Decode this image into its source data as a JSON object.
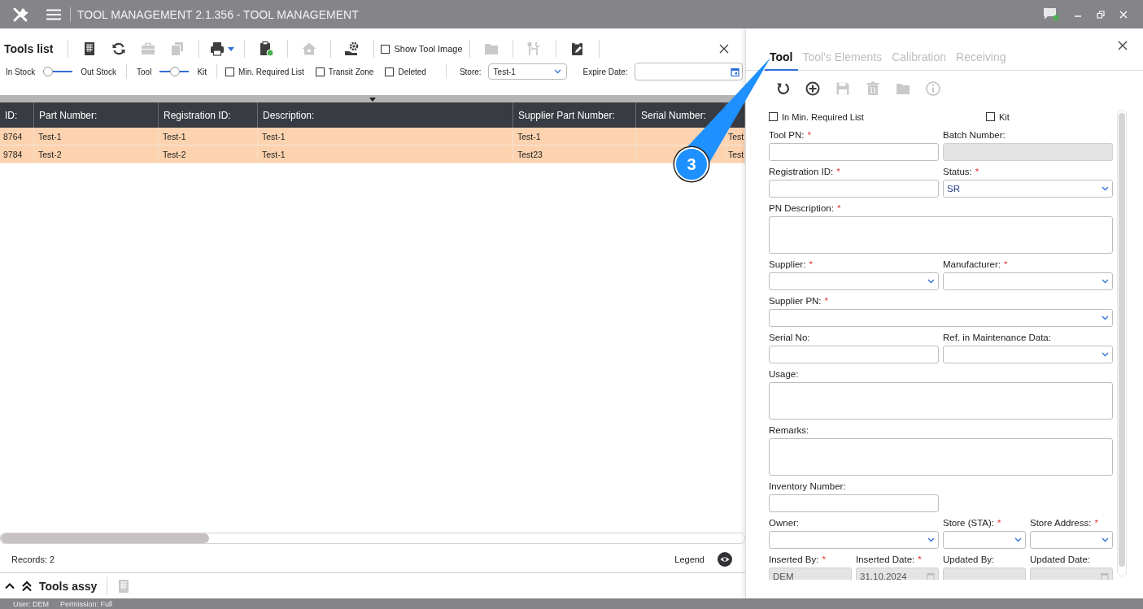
{
  "window": {
    "title": "TOOL MANAGEMENT 2.1.356 - TOOL MANAGEMENT"
  },
  "tools_list": {
    "title": "Tools list",
    "toolbar_groups": [
      [
        {
          "kind": "spreadsheet",
          "disabled": false
        },
        {
          "kind": "refresh",
          "disabled": false
        },
        {
          "kind": "toolbox",
          "disabled": true
        },
        {
          "kind": "copy",
          "disabled": true
        }
      ],
      [
        {
          "kind": "printer",
          "disabled": false
        }
      ],
      [
        {
          "kind": "clipboard",
          "disabled": false
        }
      ],
      [
        {
          "kind": "house",
          "disabled": true
        }
      ],
      [
        {
          "kind": "hand-gear",
          "disabled": false
        }
      ],
      [
        {
          "kind": "checkbox",
          "label": "Show Tool Image",
          "checked": false
        }
      ],
      [
        {
          "kind": "folder",
          "disabled": true
        }
      ],
      [
        {
          "kind": "tools",
          "disabled": true
        }
      ],
      [
        {
          "kind": "clipboard-pencil",
          "disabled": false
        }
      ]
    ],
    "toggles": [
      {
        "left": "In Stock",
        "right": "Out Stock",
        "level": 0
      },
      {
        "left": "Tool",
        "right": "Kit",
        "level": 0.5
      }
    ],
    "filters": [
      {
        "label": "Min. Required List",
        "checked": false
      },
      {
        "label": "Transit Zone",
        "checked": false
      },
      {
        "label": "Deleted",
        "checked": false
      }
    ],
    "store": {
      "label": "Store:",
      "value": "Test-1"
    },
    "expire_date": {
      "label": "Expire Date:"
    }
  },
  "table": {
    "columns": [
      "ID:",
      "Part Number:",
      "Registration ID:",
      "Description:",
      "Supplier Part Number:",
      "Serial Number:"
    ],
    "rows": [
      {
        "cells": [
          "8764",
          "Test-1",
          "Test-1",
          "Test-1",
          "Test-1",
          "",
          "Test"
        ]
      },
      {
        "cells": [
          "9784",
          "Test-2",
          "Test-2",
          "Test-1",
          "Test23",
          "",
          "Test"
        ]
      }
    ]
  },
  "footer": {
    "records": "Records: 2",
    "legend": "Legend"
  },
  "assy": {
    "title": "Tools assy",
    "toolbar": [
      {
        "kind": "spreadsheet",
        "disabled": true
      }
    ]
  },
  "status_bar": {
    "user": "User: DEM",
    "permission": "Permission: Full"
  },
  "detail": {
    "tabs": [
      {
        "label": "Tool",
        "selected": true
      },
      {
        "label": "Tool's Elements",
        "selected": false
      },
      {
        "label": "Calibration",
        "selected": false
      },
      {
        "label": "Receiving",
        "selected": false
      }
    ],
    "actions": [
      {
        "kind": "undo",
        "disabled": false
      },
      {
        "kind": "add",
        "disabled": false
      },
      {
        "kind": "floppy",
        "disabled": true
      },
      {
        "kind": "trash",
        "disabled": true
      },
      {
        "kind": "folder",
        "disabled": true
      },
      {
        "kind": "info",
        "disabled": true
      }
    ],
    "checkboxes": [
      {
        "label": "In Min. Required List",
        "checked": false
      },
      {
        "label": "Kit",
        "checked": false
      }
    ],
    "field_groups": [
      [
        {
          "label": "Tool PN:",
          "marker": "*",
          "kind": "text",
          "disabled": false
        },
        {
          "label": "Batch Number:",
          "kind": "text",
          "disabled": true
        }
      ],
      [
        {
          "label": "Registration ID:",
          "marker": "*",
          "kind": "text",
          "disabled": false
        },
        {
          "label": "Status:",
          "marker": "*",
          "kind": "select",
          "value": "SR",
          "disabled": false
        }
      ],
      [
        {
          "label": "PN Description:",
          "marker": "*",
          "kind": "textarea",
          "disabled": false
        }
      ],
      [
        {
          "label": "Supplier:",
          "marker": "*",
          "kind": "select",
          "disabled": false
        },
        {
          "label": "Manufacturer:",
          "marker": "*",
          "kind": "select",
          "disabled": false
        }
      ],
      [
        {
          "label": "Supplier PN:",
          "marker": "*",
          "kind": "select",
          "disabled": false
        }
      ],
      [
        {
          "label": "Serial No:",
          "kind": "text",
          "disabled": false
        },
        {
          "label": "Ref. in Maintenance Data:",
          "kind": "select",
          "disabled": false
        }
      ],
      [
        {
          "label": "Usage:",
          "kind": "textarea",
          "disabled": false
        }
      ],
      [
        {
          "label": "Remarks:",
          "kind": "textarea",
          "disabled": false
        }
      ],
      [
        {
          "label": "Inventory Number:",
          "kind": "text",
          "disabled": false
        }
      ],
      [
        {
          "label": "Owner:",
          "kind": "select",
          "disabled": false
        },
        {
          "label": "Store (STA):",
          "marker": "*",
          "kind": "select",
          "disabled": false
        },
        {
          "label": "Store Address:",
          "marker": "*",
          "kind": "select",
          "disabled": false
        }
      ],
      [
        {
          "label": "Inserted By:",
          "marker": "*",
          "kind": "text",
          "value": "DEM",
          "disabled": true
        },
        {
          "label": "Inserted Date:",
          "marker": "*",
          "kind": "date",
          "value": "31.10.2024",
          "disabled": true
        },
        {
          "label": "Updated By:",
          "kind": "text",
          "disabled": true
        },
        {
          "label": "Updated Date:",
          "kind": "date",
          "disabled": true
        }
      ]
    ]
  },
  "callout": {
    "number": "3"
  }
}
